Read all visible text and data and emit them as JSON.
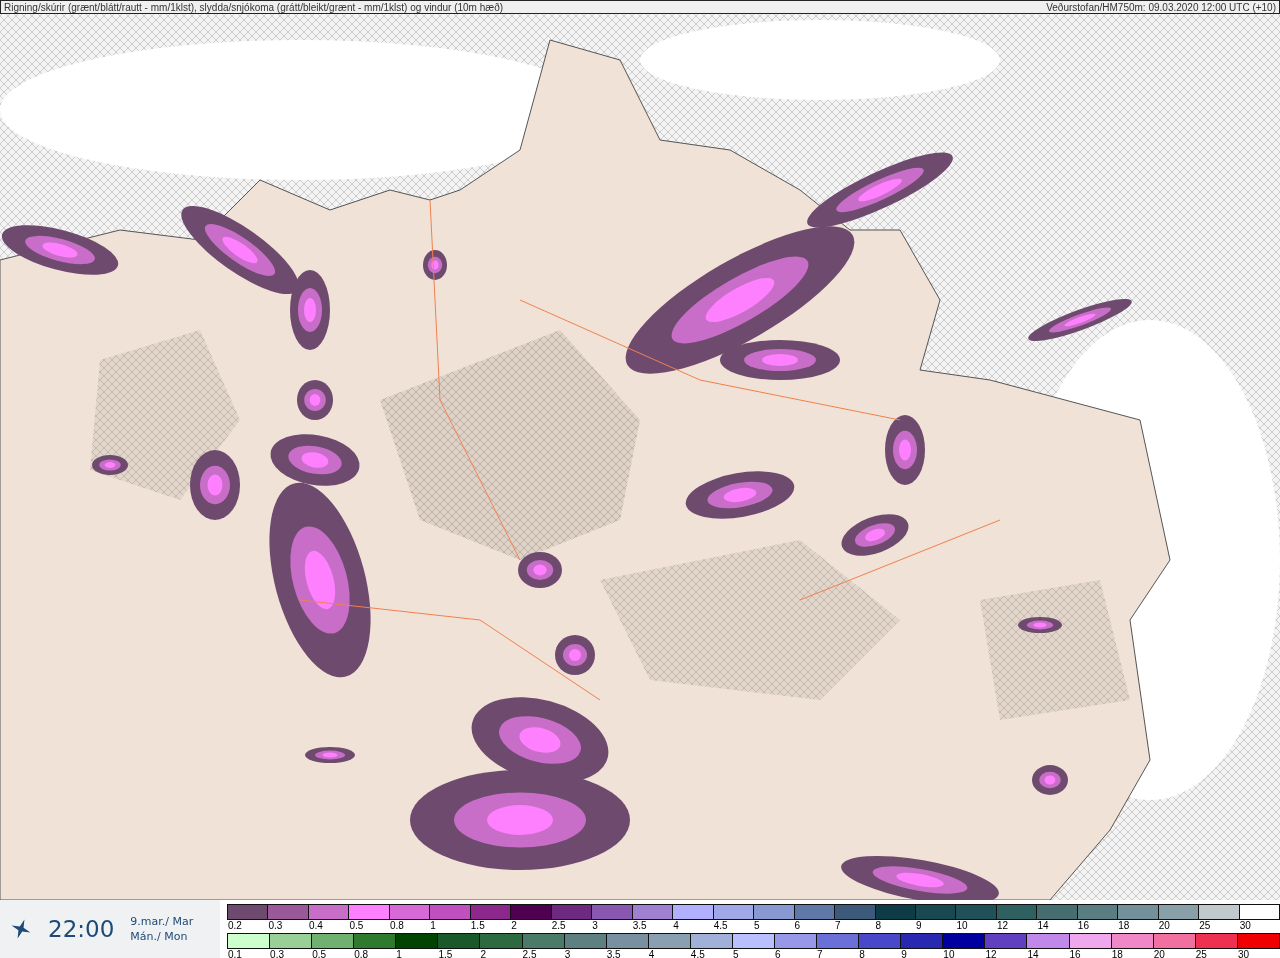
{
  "header": {
    "title": "Rigning/skúrir (grænt/blátt/rautt - mm/1klst), slydda/snjókoma (grátt/bleikt/grænt - mm/1klst) og vindur (10m hæð)",
    "source": "Veðurstofan/HM750m: 09.03.2020 12:00 UTC (+10)"
  },
  "time_panel": {
    "time": "22:00",
    "date": "9.mar./ Mar",
    "weekday": "Mán./ Mon"
  },
  "legends": [
    {
      "items": [
        {
          "label": "0.2",
          "color": "#6e4a6e"
        },
        {
          "label": "0.3",
          "color": "#9a5a9a"
        },
        {
          "label": "0.4",
          "color": "#c86ec8"
        },
        {
          "label": "0.5",
          "color": "#ff80ff"
        },
        {
          "label": "0.8",
          "color": "#d86ad8"
        },
        {
          "label": "1",
          "color": "#c050c0"
        },
        {
          "label": "1.5",
          "color": "#8c288c"
        },
        {
          "label": "2",
          "color": "#500050"
        },
        {
          "label": "2.5",
          "color": "#6e2a80"
        },
        {
          "label": "3",
          "color": "#8858b0"
        },
        {
          "label": "3.5",
          "color": "#a080d0"
        },
        {
          "label": "4",
          "color": "#b0b0ff"
        },
        {
          "label": "4.5",
          "color": "#a0a8e8"
        },
        {
          "label": "5",
          "color": "#8898d0"
        },
        {
          "label": "6",
          "color": "#6078a8"
        },
        {
          "label": "7",
          "color": "#3e5a7a"
        },
        {
          "label": "8",
          "color": "#0e3c46"
        },
        {
          "label": "9",
          "color": "#184850"
        },
        {
          "label": "10",
          "color": "#205058"
        },
        {
          "label": "12",
          "color": "#2e6060"
        },
        {
          "label": "14",
          "color": "#466e70"
        },
        {
          "label": "16",
          "color": "#5a7e82"
        },
        {
          "label": "18",
          "color": "#74909a"
        },
        {
          "label": "20",
          "color": "#8aa0a8"
        },
        {
          "label": "25",
          "color": "#c0cacc"
        },
        {
          "label": "30",
          "color": "#ffffff"
        }
      ]
    },
    {
      "items": [
        {
          "label": "0.1",
          "color": "#ccffcc"
        },
        {
          "label": "0.3",
          "color": "#98d098"
        },
        {
          "label": "0.5",
          "color": "#70b070"
        },
        {
          "label": "0.8",
          "color": "#2e7a2e"
        },
        {
          "label": "1",
          "color": "#004400"
        },
        {
          "label": "1.5",
          "color": "#1a5a2a"
        },
        {
          "label": "2",
          "color": "#2e6a40"
        },
        {
          "label": "2.5",
          "color": "#4a7a68"
        },
        {
          "label": "3",
          "color": "#5e8080"
        },
        {
          "label": "3.5",
          "color": "#7890a0"
        },
        {
          "label": "4",
          "color": "#8aa0b0"
        },
        {
          "label": "4.5",
          "color": "#a0b0d8"
        },
        {
          "label": "5",
          "color": "#b8c0ff"
        },
        {
          "label": "6",
          "color": "#9898e8"
        },
        {
          "label": "7",
          "color": "#6a70d8"
        },
        {
          "label": "8",
          "color": "#4848c8"
        },
        {
          "label": "9",
          "color": "#2828b0"
        },
        {
          "label": "10",
          "color": "#0000a0"
        },
        {
          "label": "12",
          "color": "#6040c0"
        },
        {
          "label": "14",
          "color": "#c088e8"
        },
        {
          "label": "16",
          "color": "#f0a8ec"
        },
        {
          "label": "18",
          "color": "#f088c8"
        },
        {
          "label": "20",
          "color": "#f070a0"
        },
        {
          "label": "25",
          "color": "#f03050"
        },
        {
          "label": "30",
          "color": "#f00000"
        }
      ]
    }
  ]
}
